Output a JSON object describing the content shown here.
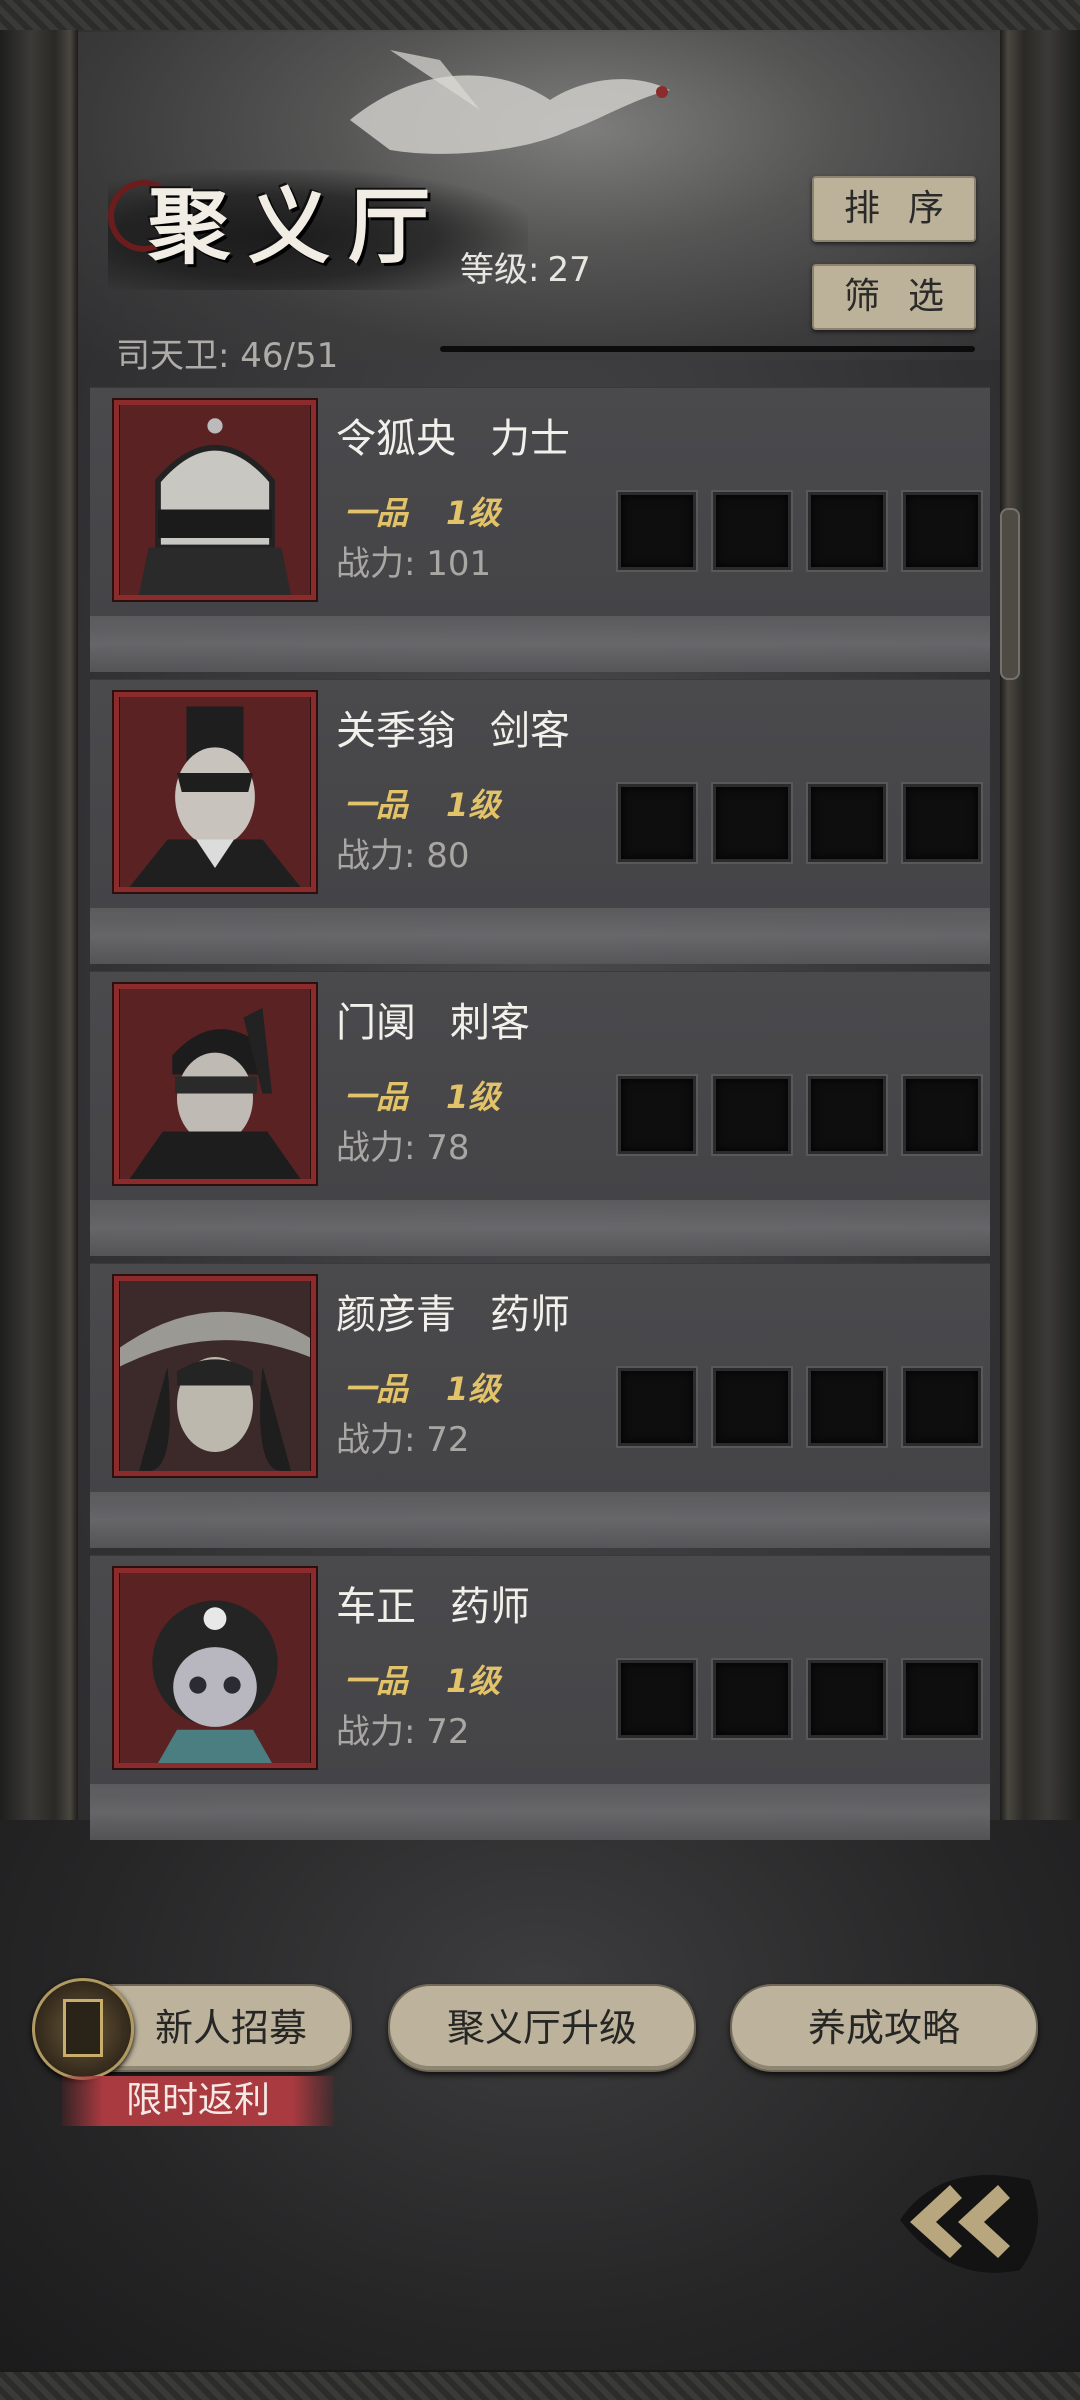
{
  "header": {
    "title": "聚义厅",
    "level_label": "等级:",
    "level_value": "27",
    "guard_count": "司天卫: 46/51"
  },
  "buttons": {
    "sort": "排序",
    "filter": "筛选"
  },
  "heroes": [
    {
      "name": "令狐央",
      "role": "力士",
      "grade": "一品",
      "level": "1级",
      "power": "战力: 101",
      "portrait": "helmet-warrior"
    },
    {
      "name": "关季翁",
      "role": "剑客",
      "grade": "一品",
      "level": "1级",
      "power": "战力: 80",
      "portrait": "swordsman"
    },
    {
      "name": "门阒",
      "role": "刺客",
      "grade": "一品",
      "level": "1级",
      "power": "战力: 78",
      "portrait": "masked-assassin"
    },
    {
      "name": "颜彦青",
      "role": "药师",
      "grade": "一品",
      "level": "1级",
      "power": "战力: 72",
      "portrait": "hat-woman"
    },
    {
      "name": "车正",
      "role": "药师",
      "grade": "一品",
      "level": "1级",
      "power": "战力: 72",
      "portrait": "child-healer"
    }
  ],
  "bottom": {
    "recruit": "新人招募",
    "upgrade": "聚义厅升级",
    "guide": "养成攻略",
    "promo": "限时返利"
  },
  "colors": {
    "accent_gold": "#e3c36a",
    "frame_red": "#8c2b2b",
    "button_tan": "#bdb39c",
    "promo_red": "#a83a40"
  }
}
